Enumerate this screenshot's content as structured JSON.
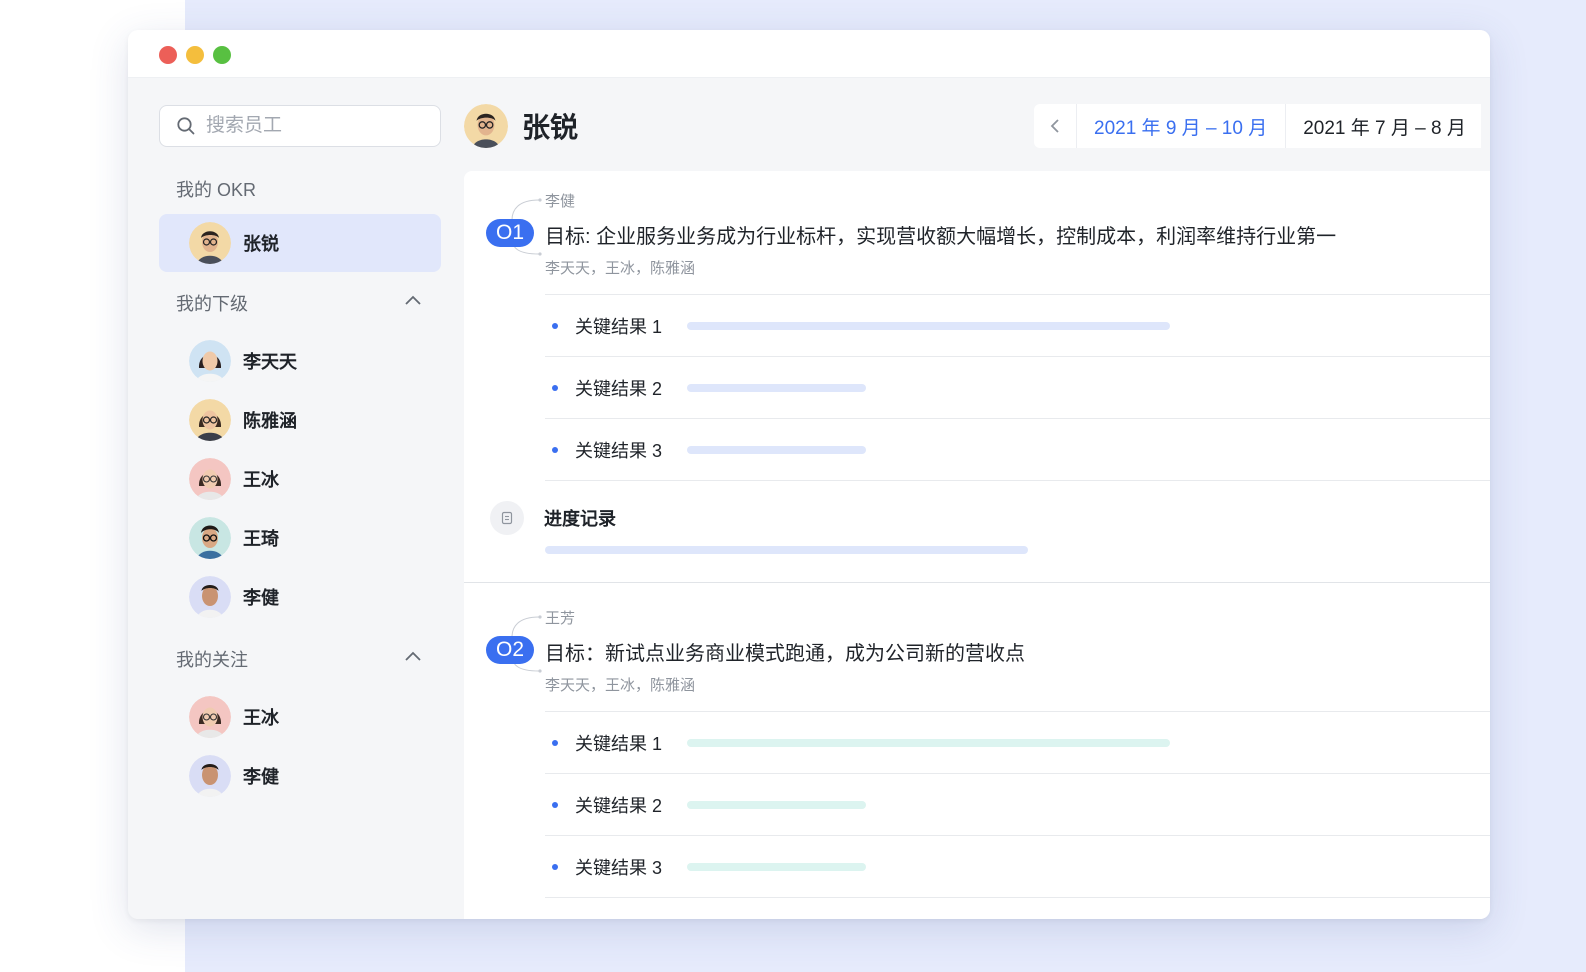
{
  "search": {
    "placeholder": "搜索员工"
  },
  "sidebar": {
    "my_okr": {
      "title": "我的 OKR",
      "people": [
        {
          "name": "张锐",
          "avatar": "man-glasses-avatar"
        }
      ]
    },
    "subordinates": {
      "title": "我的下级",
      "people": [
        {
          "name": "李天天",
          "avatar": "woman-avatar"
        },
        {
          "name": "陈雅涵",
          "avatar": "woman-glasses-avatar"
        },
        {
          "name": "王冰",
          "avatar": "woman-avatar"
        },
        {
          "name": "王琦",
          "avatar": "man-glasses-avatar"
        },
        {
          "name": "李健",
          "avatar": "man-avatar"
        }
      ]
    },
    "following": {
      "title": "我的关注",
      "people": [
        {
          "name": "王冰",
          "avatar": "woman-avatar"
        },
        {
          "name": "李健",
          "avatar": "man-avatar"
        }
      ]
    }
  },
  "header": {
    "name": "张锐",
    "periods": [
      "2021 年 9 月 – 10 月",
      "2021 年 7 月 – 8 月"
    ]
  },
  "objectives": [
    {
      "badge": "O1",
      "owner": "李健",
      "title": "目标: 企业服务业务成为行业标杆，实现营收额大幅增长，控制成本，利润率维持行业第一",
      "supporters": "李天天，王冰，陈雅涵",
      "key_results": [
        {
          "label": "关键结果 1",
          "progress": 1.0
        },
        {
          "label": "关键结果 2",
          "progress": 0.37
        },
        {
          "label": "关键结果 3",
          "progress": 0.37
        }
      ],
      "progress_record": {
        "label": "进度记录",
        "progress": 1.0
      }
    },
    {
      "badge": "O2",
      "owner": "王芳",
      "title": "目标：新试点业务商业模式跑通，成为公司新的营收点",
      "supporters": "李天天，王冰，陈雅涵",
      "key_results": [
        {
          "label": "关键结果 1",
          "progress": 1.0
        },
        {
          "label": "关键结果 2",
          "progress": 0.37
        },
        {
          "label": "关键结果 3",
          "progress": 0.37
        }
      ]
    }
  ],
  "colors": {
    "accent": "#3a6ff0",
    "kr_bar_o1": "#dee6fb",
    "kr_bar_o2": "#dcf4f0"
  }
}
